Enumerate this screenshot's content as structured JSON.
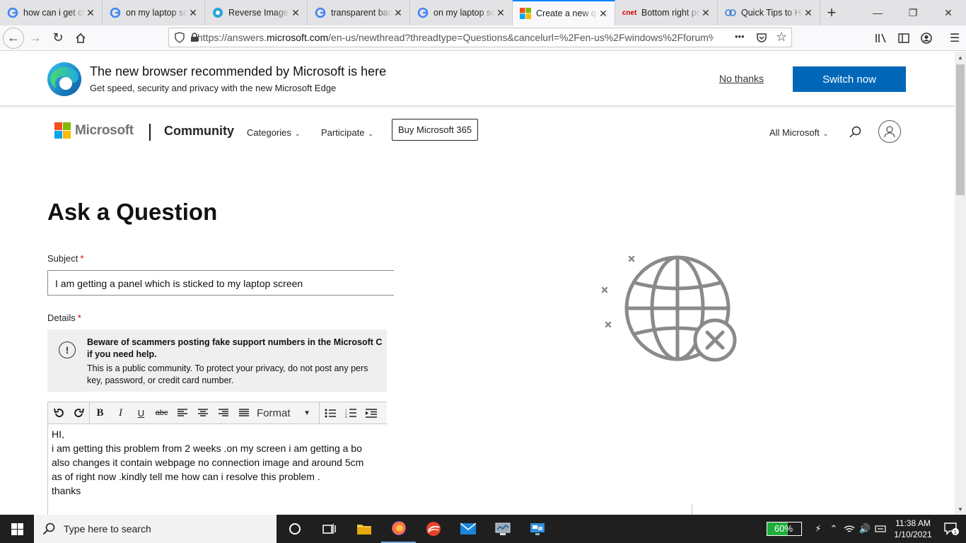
{
  "browser": {
    "tabs": [
      {
        "title": "how can i get cl",
        "favicon": "google-icon",
        "active": false
      },
      {
        "title": "on my laptop sc",
        "favicon": "google-icon",
        "active": false
      },
      {
        "title": "Reverse Image S",
        "favicon": "reverse-image-icon",
        "active": false
      },
      {
        "title": "transparent bac",
        "favicon": "google-icon",
        "active": false
      },
      {
        "title": "on my laptop sc",
        "favicon": "google-icon",
        "active": false
      },
      {
        "title": "Create a new qu",
        "favicon": "microsoft-icon",
        "active": true
      },
      {
        "title": "Bottom right po",
        "favicon": "cnet-icon",
        "active": false
      },
      {
        "title": "Quick Tips to H",
        "favicon": "quick-tips-icon",
        "active": false
      }
    ],
    "cnet_label": "cnet",
    "url_prefix": "https://answers.",
    "url_domain": "microsoft.com",
    "url_rest": "/en-us/newthread?threadtype=Questions&cancelurl=%2Fen-us%2Fwindows%2Fforum%2",
    "more_label": "•••"
  },
  "banner": {
    "title": "The new browser recommended by Microsoft is here",
    "subtitle": "Get speed, security and privacy with the new Microsoft Edge",
    "no_thanks": "No thanks",
    "switch_now": "Switch now"
  },
  "header": {
    "brand": "Microsoft",
    "community": "Community",
    "categories": "Categories",
    "participate": "Participate",
    "buy": "Buy Microsoft 365",
    "all_microsoft": "All Microsoft",
    "brand_colors": [
      "#f25022",
      "#7fba00",
      "#00a4ef",
      "#ffb900"
    ]
  },
  "form": {
    "page_title": "Ask a Question",
    "subject_label": "Subject",
    "required_mark": "*",
    "subject_value": "I am getting a panel which is sticked to my laptop screen",
    "details_label": "Details",
    "warning_bold_line1": "Beware of scammers posting fake support numbers in the Microsoft C",
    "warning_bold_line2": "if you need help.",
    "warning_line1": "This is a public community. To protect your privacy, do not post any pers",
    "warning_line2": "key, password, or credit card number.",
    "format_label": "Format",
    "body_lines": [
      "HI,",
      "i am getting this problem from 2 weeks .on my screen i am getting a bo",
      "also changes it contain webpage no connection image and around 5cm",
      "as of right now .kindly tell me how can i resolve this problem .",
      "thanks"
    ]
  },
  "taskbar": {
    "search_placeholder": "Type here to search",
    "battery": "60%",
    "battery_level": 0.6,
    "time": "11:38 AM",
    "date": "1/10/2021",
    "notification_count": "1"
  }
}
